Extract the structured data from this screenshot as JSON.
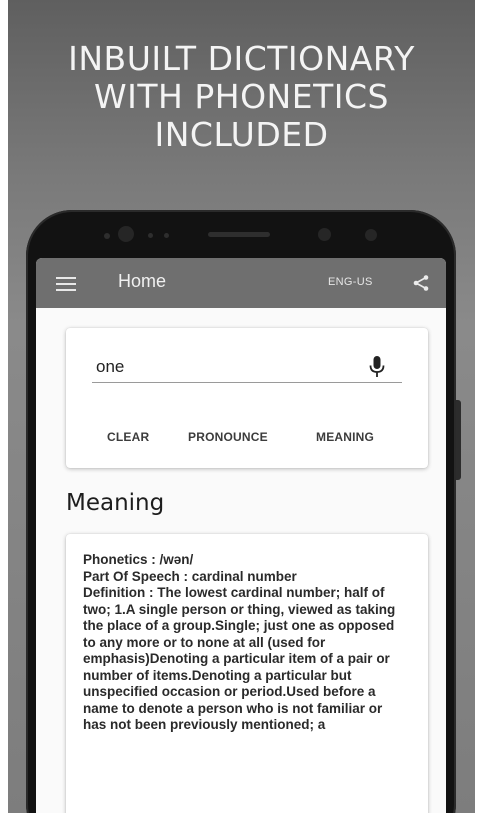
{
  "promo": {
    "headline_lines": [
      "INBUILT DICTIONARY",
      "WITH PHONETICS",
      "INCLUDED"
    ]
  },
  "appbar": {
    "title": "Home",
    "language": "ENG-US",
    "icons": {
      "menu": "hamburger-menu-icon",
      "share": "share-icon"
    }
  },
  "search": {
    "value": "one",
    "placeholder": "",
    "mic_icon": "microphone-icon",
    "buttons": {
      "clear": "CLEAR",
      "pronounce": "PRONOUNCE",
      "meaning": "MEANING"
    }
  },
  "meaning": {
    "heading": "Meaning",
    "phonetics": "Phonetics : /wən/",
    "part_of_speech": "Part Of Speech : cardinal number",
    "definition": "Definition : The lowest cardinal number; half of two; 1.A single person or thing, viewed as taking the place of a group.Single; just one as opposed to any more or to none at all (used for emphasis)Denoting a particular item of a pair or number of items.Denoting a particular but unspecified occasion or period.Used before a name to denote a person who is not familiar or has not been previously mentioned; a"
  },
  "colors": {
    "background_top": "#5f5f5f",
    "background_bottom": "#7d7d7d",
    "appbar": "#6f6f6f",
    "phone_body": "#121212",
    "screen": "#fafafa"
  }
}
